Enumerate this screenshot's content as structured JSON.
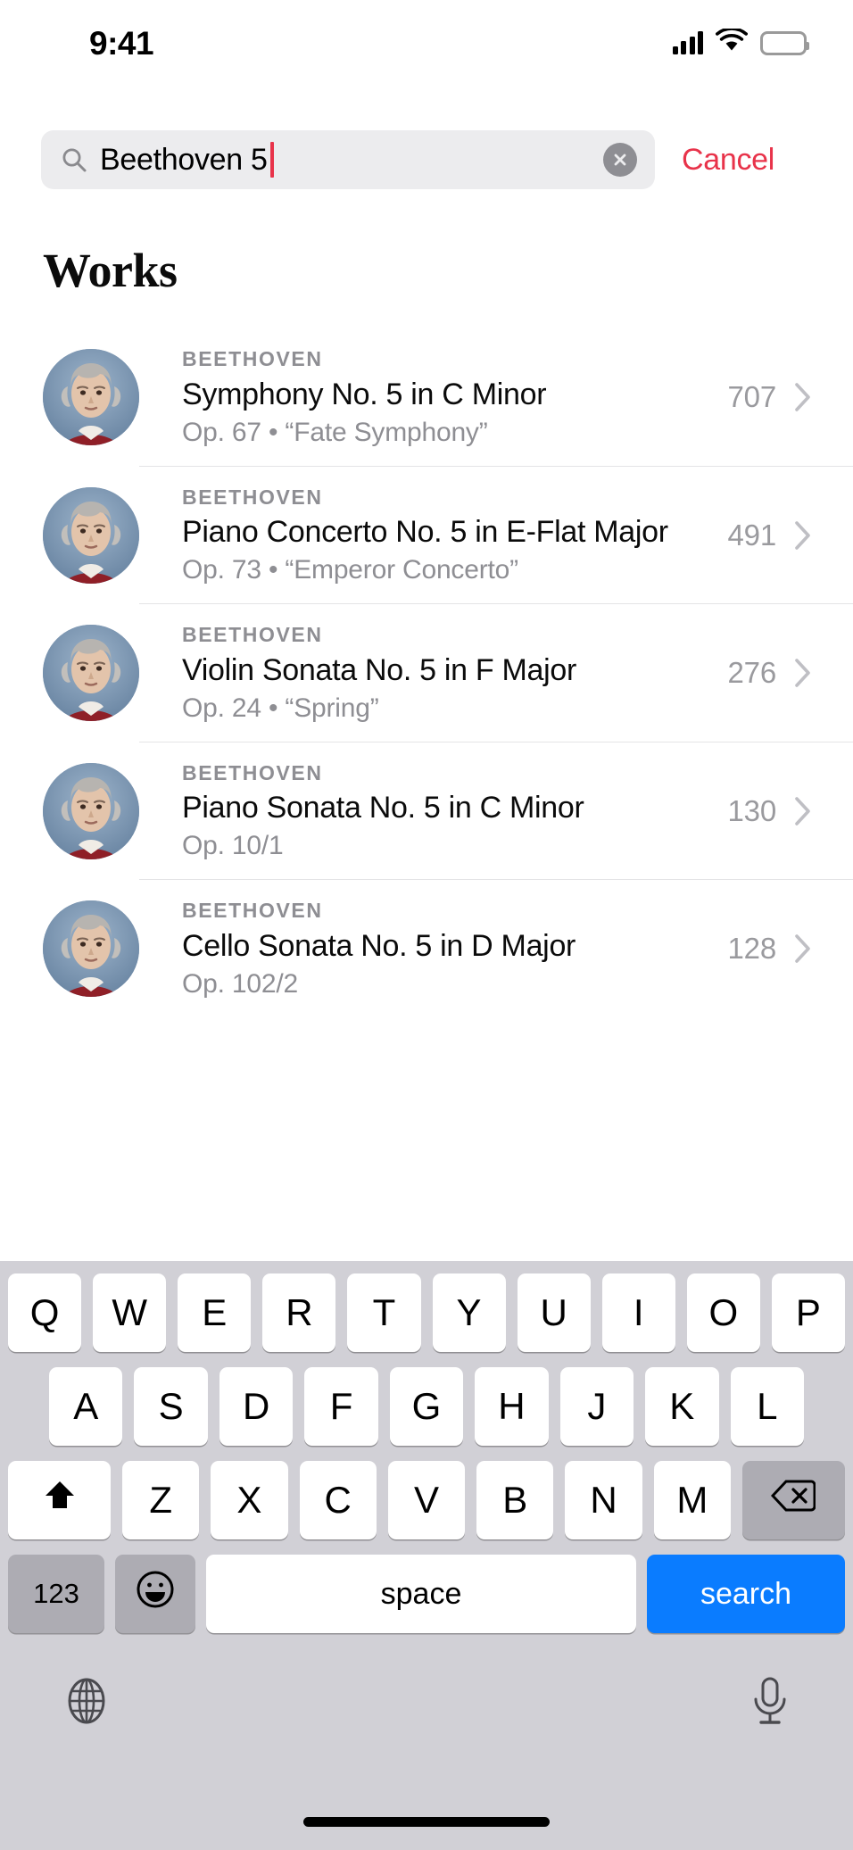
{
  "status_bar": {
    "time": "9:41",
    "cellular_icon": "signal-bars-icon",
    "wifi_icon": "wifi-icon",
    "battery_icon": "battery-full-icon"
  },
  "search": {
    "value": "Beethoven 5",
    "placeholder": "Search",
    "search_icon": "search-icon",
    "clear_icon": "clear-circle-icon",
    "cancel_label": "Cancel",
    "cancel_color": "#e8334a",
    "caret_color": "#e8334a",
    "field_background": "#ececee"
  },
  "section": {
    "title": "Works"
  },
  "results": [
    {
      "avatar": "beethoven-portrait-avatar",
      "kicker": "BEETHOVEN",
      "title": "Symphony No. 5 in C Minor",
      "subtitle": "Op. 67 • “Fate Symphony”",
      "count": "707",
      "chevron": "chevron-right-icon"
    },
    {
      "avatar": "beethoven-portrait-avatar",
      "kicker": "BEETHOVEN",
      "title": "Piano Concerto No. 5 in E-Flat Major",
      "subtitle": "Op. 73 • “Emperor Concerto”",
      "count": "491",
      "chevron": "chevron-right-icon"
    },
    {
      "avatar": "beethoven-portrait-avatar",
      "kicker": "BEETHOVEN",
      "title": "Violin Sonata No. 5 in F Major",
      "subtitle": "Op. 24 • “Spring”",
      "count": "276",
      "chevron": "chevron-right-icon"
    },
    {
      "avatar": "beethoven-portrait-avatar",
      "kicker": "BEETHOVEN",
      "title": "Piano Sonata No. 5 in C Minor",
      "subtitle": "Op. 10/1",
      "count": "130",
      "chevron": "chevron-right-icon"
    },
    {
      "avatar": "beethoven-portrait-avatar",
      "kicker": "BEETHOVEN",
      "title": "Cello Sonata No. 5 in D Major",
      "subtitle": "Op. 102/2",
      "count": "128",
      "chevron": "chevron-right-icon"
    }
  ],
  "keyboard": {
    "row1": [
      "Q",
      "W",
      "E",
      "R",
      "T",
      "Y",
      "U",
      "I",
      "O",
      "P"
    ],
    "row2": [
      "A",
      "S",
      "D",
      "F",
      "G",
      "H",
      "J",
      "K",
      "L"
    ],
    "row3_letters": [
      "Z",
      "X",
      "C",
      "V",
      "B",
      "N",
      "M"
    ],
    "shift_icon": "shift-up-arrow-icon",
    "backspace_icon": "backspace-delete-icon",
    "numbers_label": "123",
    "emoji_icon": "emoji-smiley-icon",
    "space_label": "space",
    "return_label": "search",
    "return_color": "#0a7cff",
    "globe_icon": "globe-language-icon",
    "mic_icon": "microphone-dictation-icon",
    "background": "#d1d0d6"
  }
}
